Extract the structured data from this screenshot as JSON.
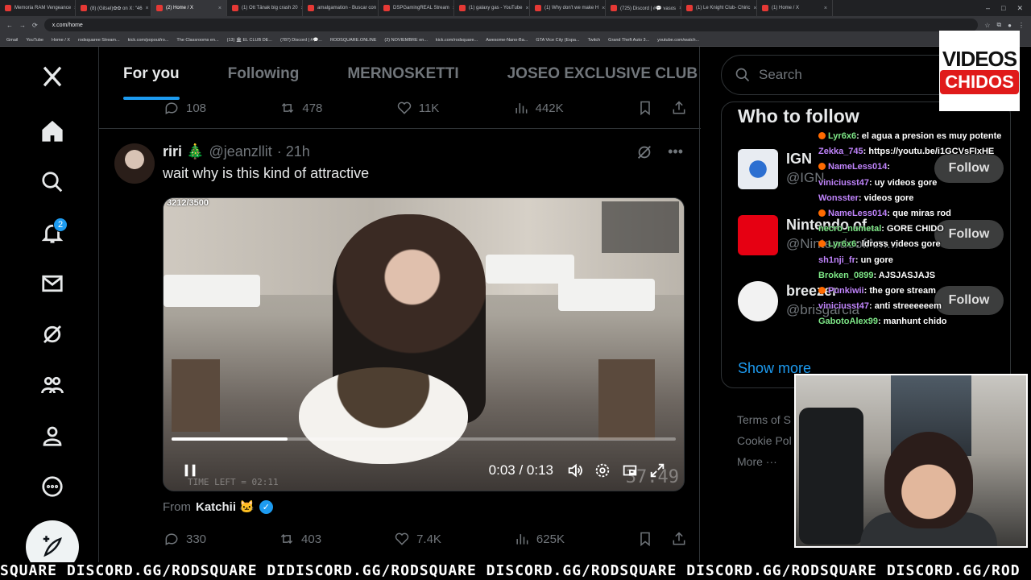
{
  "browser": {
    "tabs": [
      {
        "label": "Memoria RAM Vengeance",
        "active": false
      },
      {
        "label": "(8) (Gitsel)✿✿ on X: \"46",
        "active": false
      },
      {
        "label": "(2) Home / X",
        "active": true
      },
      {
        "label": "(1) Ott Tänak big crash 20",
        "active": false
      },
      {
        "label": "amalgamation - Buscar con",
        "active": false
      },
      {
        "label": "DSPGamingREAL Stream",
        "active": false
      },
      {
        "label": "(1) galaxy gas - YouTube",
        "active": false
      },
      {
        "label": "(1) Why don't we make H",
        "active": false
      },
      {
        "label": "(725) Discord | #💬 vasos",
        "active": false
      },
      {
        "label": "(1) Le Knight Club- Chiric",
        "active": false
      },
      {
        "label": "(1) Home / X",
        "active": false
      }
    ],
    "url": "x.com/home",
    "bookmarks": [
      "Gmail",
      "YouTube",
      "Home / X",
      "rodsquaree Stream...",
      "kick.com/popout/ro...",
      "The Classrooms en...",
      "(13) 🏛 EL CLUB DE...",
      "(787) Discord | #💬...",
      "RODSQUARE.ONLINE",
      "(2) NOVIEMBRE en...",
      "kick.com/rodsquare...",
      "Awesome-Nano-Ba...",
      "GTA Vice City (Espa...",
      "Twitch",
      "Grand Theft Auto 3...",
      "youtube.com/watch..."
    ]
  },
  "nav": {
    "notifications_badge": "2"
  },
  "feed": {
    "tabs": [
      "For you",
      "Following",
      "MERNOSKETTI",
      "JOSEO EXCLUSIVE CLUB"
    ],
    "prev_post_stats": {
      "replies": "108",
      "reposts": "478",
      "likes": "11K",
      "views": "442K"
    },
    "post": {
      "name": "riri 🎄",
      "handle": "@jeanzllit",
      "time": "· 21h",
      "text": "wait why is this kind of attractive",
      "video": {
        "overlay_counter": "3212/3500",
        "time_display": "0:03 / 0:13",
        "progress": 0.23,
        "time_left_watermark": "TIME LEFT = 02:11",
        "big_watermark": "37:49"
      },
      "from_label": "From",
      "source": "Katchii 🐱",
      "stats": {
        "replies": "330",
        "reposts": "403",
        "likes": "7.4K",
        "views": "625K"
      }
    }
  },
  "sidebar": {
    "search_placeholder": "Search",
    "who_to_follow_title": "Who to follow",
    "accounts": [
      {
        "name": "IGN",
        "handle": "@IGN",
        "button": "Follow",
        "color": "#e8ecf2"
      },
      {
        "name": "Nintendo of...",
        "handle": "@NintendoofAm...",
        "button": "Follow",
        "color": "#e60012"
      },
      {
        "name": "breezer",
        "handle": "@brisgarcia",
        "button": "Follow",
        "color": "#f2f2f2"
      }
    ],
    "show_more": "Show more",
    "footer": [
      "Terms of S",
      "Cookie Pol",
      "More ···"
    ]
  },
  "stream": {
    "logo_line1": "VIDEOS",
    "logo_line2": "CHIDOS",
    "chat": [
      {
        "user": "Lyr6x6",
        "text": ": el agua a presion es muy potente",
        "color": "#7ee787",
        "badge": true
      },
      {
        "user": "Zekka_745",
        "text": ": https://youtu.be/i1GCVsFIxHE",
        "color": "#c084fc",
        "badge": false
      },
      {
        "user": "NameLess014",
        "text": ":",
        "color": "#c084fc",
        "badge": true
      },
      {
        "user": "viniciusst47",
        "text": ": uy videos gore",
        "color": "#c084fc",
        "badge": false
      },
      {
        "user": "Wonsster",
        "text": ": videos gore",
        "color": "#c084fc",
        "badge": false
      },
      {
        "user": "NameLess014",
        "text": ": que miras rod",
        "color": "#c084fc",
        "badge": true
      },
      {
        "user": "necro_numetal",
        "text": ": GORE CHIDO",
        "color": "#7ee787",
        "badge": false
      },
      {
        "user": "Lyr6x6",
        "text": ": ldross videos gore",
        "color": "#7ee787",
        "badge": true
      },
      {
        "user": "sh1nji_fr",
        "text": ": un gore",
        "color": "#c084fc",
        "badge": false
      },
      {
        "user": "Broken_0899",
        "text": ": AJSJASJAJS",
        "color": "#7ee787",
        "badge": false
      },
      {
        "user": "Punkiwii",
        "text": ": the gore stream",
        "color": "#c084fc",
        "badge": true
      },
      {
        "user": "viniciusst47",
        "text": ": anti streeeeeem",
        "color": "#c084fc",
        "badge": false
      },
      {
        "user": "GabotoAlex99",
        "text": ": manhunt chido",
        "color": "#7ee787",
        "badge": false
      }
    ],
    "ticker": "SQUARE DISCORD.GG/RODSQUARE DIDISCORD.GG/RODSQUARE DISCORD.GG/RODSQUARE DISCORD.GG/RODSQUARE DISCORD.GG/ROD"
  }
}
